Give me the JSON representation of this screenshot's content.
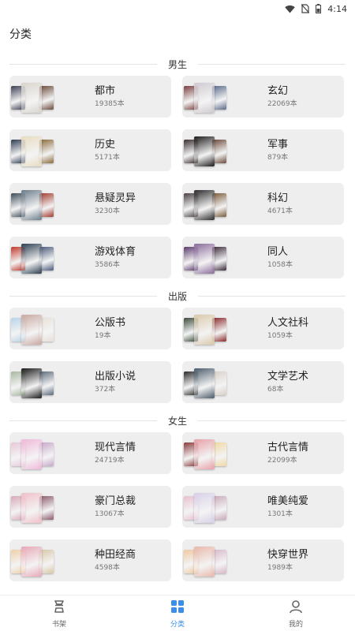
{
  "status_bar": {
    "time": "4:14",
    "icons": [
      "wifi-icon",
      "no-sim-icon",
      "battery-icon"
    ]
  },
  "header": {
    "title": "分类"
  },
  "sections": [
    {
      "title": "男生",
      "items": [
        {
          "name": "都市",
          "count": "19385本",
          "covers": [
            "#3a3f52",
            "#d9d4cc",
            "#6a4a3a"
          ]
        },
        {
          "name": "玄幻",
          "count": "22069本",
          "covers": [
            "#7b4040",
            "#cfc9cf",
            "#5a6a8a"
          ]
        },
        {
          "name": "历史",
          "count": "5171本",
          "covers": [
            "#2f3b52",
            "#e8dcc0",
            "#8a6a3a"
          ]
        },
        {
          "name": "军事",
          "count": "879本",
          "covers": [
            "#3a2e2e",
            "#1e1a1a",
            "#6b4a3a"
          ]
        },
        {
          "name": "悬疑灵异",
          "count": "3230本",
          "covers": [
            "#3c4a56",
            "#6b7c8a",
            "#a23a2e"
          ]
        },
        {
          "name": "科幻",
          "count": "4671本",
          "covers": [
            "#4a4040",
            "#2a2a2a",
            "#7a5a3a"
          ]
        },
        {
          "name": "游戏体育",
          "count": "3586本",
          "covers": [
            "#c0392b",
            "#2c3e50",
            "#4a5a7a"
          ]
        },
        {
          "name": "同人",
          "count": "1058本",
          "covers": [
            "#5a3a6a",
            "#8a6a9a",
            "#3a2a3a"
          ]
        }
      ]
    },
    {
      "title": "出版",
      "items": [
        {
          "name": "公版书",
          "count": "19本",
          "covers": [
            "#b8d4e8",
            "#c9a8a0",
            "#e8e0d8"
          ]
        },
        {
          "name": "人文社科",
          "count": "1059本",
          "covers": [
            "#3a4a3a",
            "#d8c8a8",
            "#8a2a2a"
          ]
        },
        {
          "name": "出版小说",
          "count": "372本",
          "covers": [
            "#a8b8a0",
            "#1a1a1a",
            "#5a6a7a"
          ]
        },
        {
          "name": "文学艺术",
          "count": "68本",
          "covers": [
            "#2a2a2a",
            "#4a5a6a",
            "#d8d0c8"
          ]
        }
      ]
    },
    {
      "title": "女生",
      "items": [
        {
          "name": "现代言情",
          "count": "24719本",
          "covers": [
            "#e8c8d8",
            "#f0b8d8",
            "#c8a8c8"
          ]
        },
        {
          "name": "古代言情",
          "count": "22099本",
          "covers": [
            "#8a3a3a",
            "#e8a0a8",
            "#f0d8a0"
          ]
        },
        {
          "name": "豪门总裁",
          "count": "13067本",
          "covers": [
            "#d8a8b8",
            "#f0c0c8",
            "#8a5a6a"
          ]
        },
        {
          "name": "唯美纯爱",
          "count": "1301本",
          "covers": [
            "#e8c0d0",
            "#d8d0e8",
            "#c8a8b8"
          ]
        },
        {
          "name": "种田经商",
          "count": "4598本",
          "covers": [
            "#f0d0a8",
            "#e8a8b8",
            "#d8c8a8"
          ]
        },
        {
          "name": "快穿世界",
          "count": "1989本",
          "covers": [
            "#f0c8a0",
            "#e8b8a8",
            "#d8b8c8"
          ]
        }
      ]
    }
  ],
  "tabbar": {
    "tabs": [
      {
        "label": "书架",
        "icon": "bookshelf-icon",
        "active": false
      },
      {
        "label": "分类",
        "icon": "category-icon",
        "active": true
      },
      {
        "label": "我的",
        "icon": "profile-icon",
        "active": false
      }
    ],
    "colors": {
      "active": "#3c8ee6",
      "inactive": "#666666"
    }
  }
}
